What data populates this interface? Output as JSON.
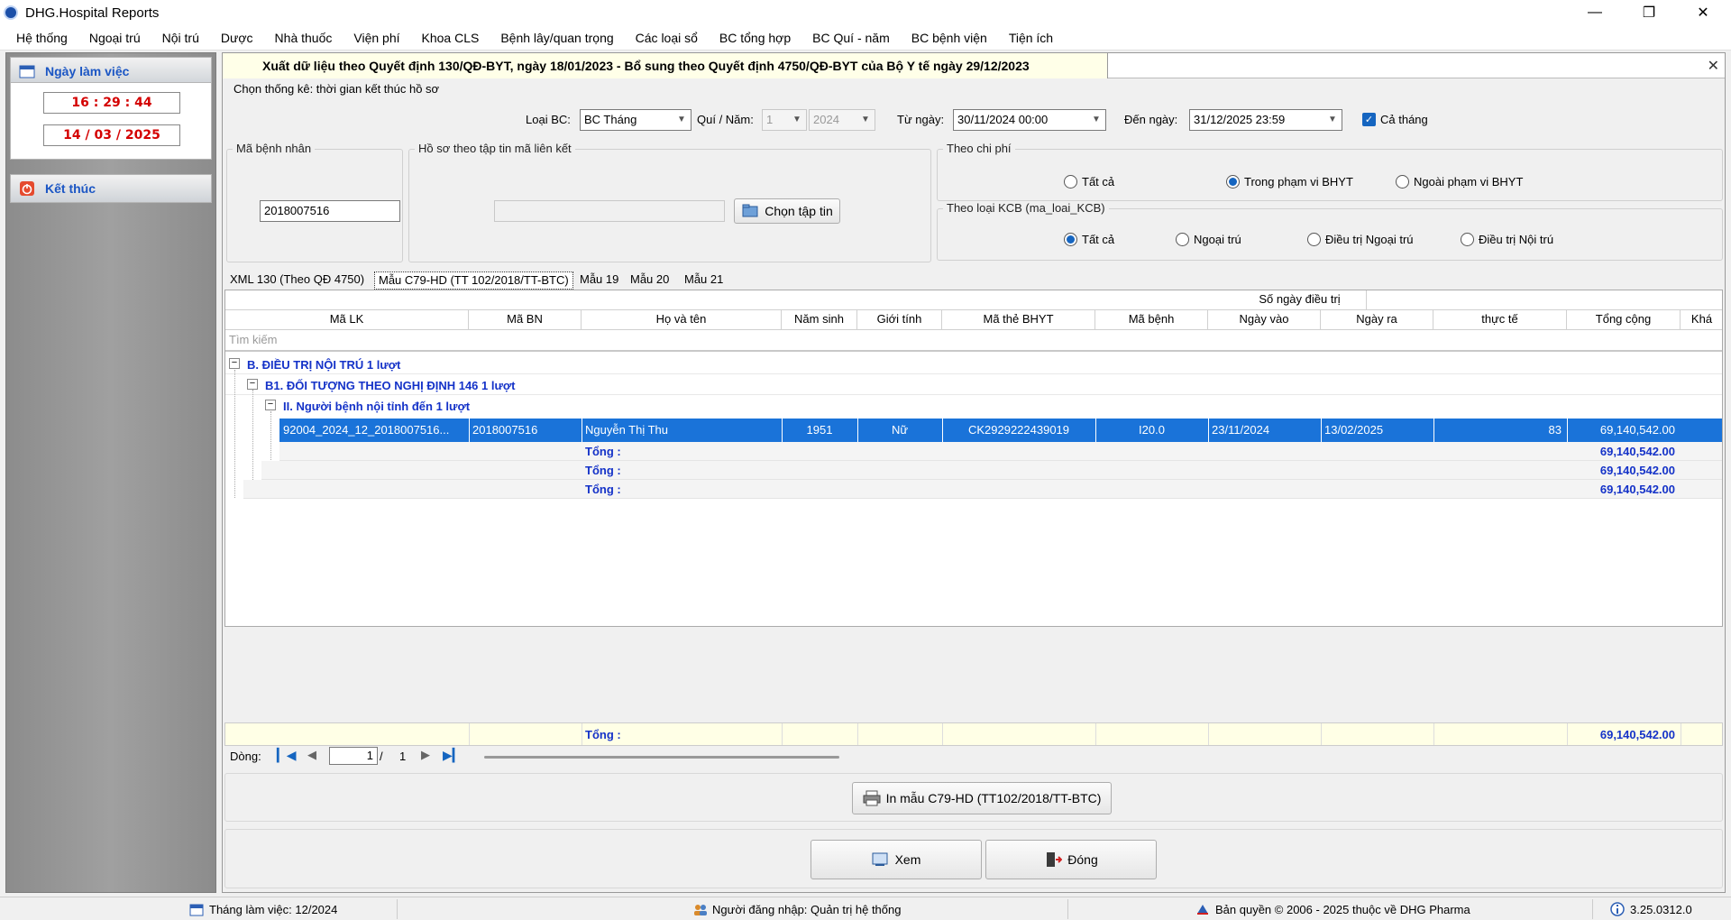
{
  "window": {
    "title": "DHG.Hospital Reports"
  },
  "menu": [
    "Hệ thống",
    "Ngoại trú",
    "Nội trú",
    "Dược",
    "Nhà thuốc",
    "Viện phí",
    "Khoa CLS",
    "Bệnh lây/quan trọng",
    "Các loại sổ",
    "BC tổng hợp",
    "BC Quí - năm",
    "BC bệnh viện",
    "Tiện ích"
  ],
  "sidebar": {
    "workday_label": "Ngày làm việc",
    "time": "16 : 29 : 44",
    "date": "14 / 03 / 2025",
    "exit_label": "Kết thúc"
  },
  "dialog": {
    "title": "Xuất dữ liệu theo Quyết định 130/QĐ-BYT, ngày 18/01/2023 - Bổ sung theo Quyết định 4750/QĐ-BYT của Bộ Y tế ngày 29/12/2023",
    "filter_group": "Chọn thống kê: thời gian kết thúc hồ sơ",
    "report_type_label": "Loại BC:",
    "report_type_value": "BC Tháng",
    "quarter_year_label": "Quí / Năm:",
    "quarter_value": "1",
    "year_value": "2024",
    "from_label": "Từ ngày:",
    "from_value": "30/11/2024 00:00",
    "to_label": "Đến ngày:",
    "to_value": "31/12/2025 23:59",
    "whole_month_label": "Cả tháng",
    "patient_group": "Mã bệnh nhân",
    "patient_value": "2018007516",
    "file_group": "Hồ sơ theo tập tin mã liên kết",
    "choose_file_label": "Chọn tập tin",
    "cost_group": "Theo chi phí",
    "cost_options": [
      "Tất cả",
      "Trong phạm vi BHYT",
      "Ngoài phạm vi BHYT"
    ],
    "kcb_group": "Theo loại KCB (ma_loai_KCB)",
    "kcb_options": [
      "Tất cả",
      "Ngoại trú",
      "Điều trị Ngoại trú",
      "Điều trị Nội trú"
    ]
  },
  "tabs": [
    "XML 130 (Theo QĐ 4750)",
    "Mẫu C79-HD (TT 102/2018/TT-BTC)",
    "Mẫu 19",
    "Mẫu 20",
    "Mẫu 21"
  ],
  "grid": {
    "columns": [
      "Mã LK",
      "Mã BN",
      "Họ và tên",
      "Năm sinh",
      "Giới tính",
      "Mã thẻ BHYT",
      "Mã bệnh",
      "Ngày vào",
      "Ngày ra",
      "thực tế",
      "Tổng cộng",
      "Khá"
    ],
    "band_header": "Số ngày điều trị",
    "search_placeholder": "Tìm kiếm",
    "groups": [
      "B. ĐIỀU TRỊ NỘI TRÚ 1 lượt",
      "B1. ĐỐI TƯỢNG THEO NGHỊ ĐỊNH 146 1 lượt",
      "II. Người bệnh nội tỉnh đến 1 lượt"
    ],
    "row": {
      "ma_lk": "92004_2024_12_2018007516...",
      "ma_bn": "2018007516",
      "ho_ten": "Nguyễn Thị Thu",
      "nam_sinh": "1951",
      "gioi_tinh": "Nữ",
      "ma_the": "CK2929222439019",
      "ma_benh": "I20.0",
      "ngay_vao": "23/11/2024",
      "ngay_ra": "13/02/2025",
      "so_ngay": "83",
      "tong_cong": "69,140,542.00"
    },
    "total_label": "Tổng :",
    "total_value": "69,140,542.00",
    "footer_total_label": "Tổng :",
    "footer_total_value": "69,140,542.00"
  },
  "pager": {
    "label": "Dòng:",
    "current": "1",
    "separator": "/",
    "total": "1"
  },
  "buttons": {
    "print": "In mẫu C79-HD (TT102/2018/TT-BTC)",
    "view": "Xem",
    "close": "Đóng"
  },
  "status": {
    "month": "Tháng làm việc: 12/2024",
    "user": "Người đăng nhập: Quản trị hệ thống",
    "copyright": "Bản quyền © 2006 - 2025 thuộc về DHG Pharma",
    "version": "3.25.0312.0"
  },
  "colors": {
    "selection": "#1a73d9",
    "group_text": "#1432c8",
    "time_text": "#d40000",
    "sidebar_head_text": "#1b56c4"
  }
}
